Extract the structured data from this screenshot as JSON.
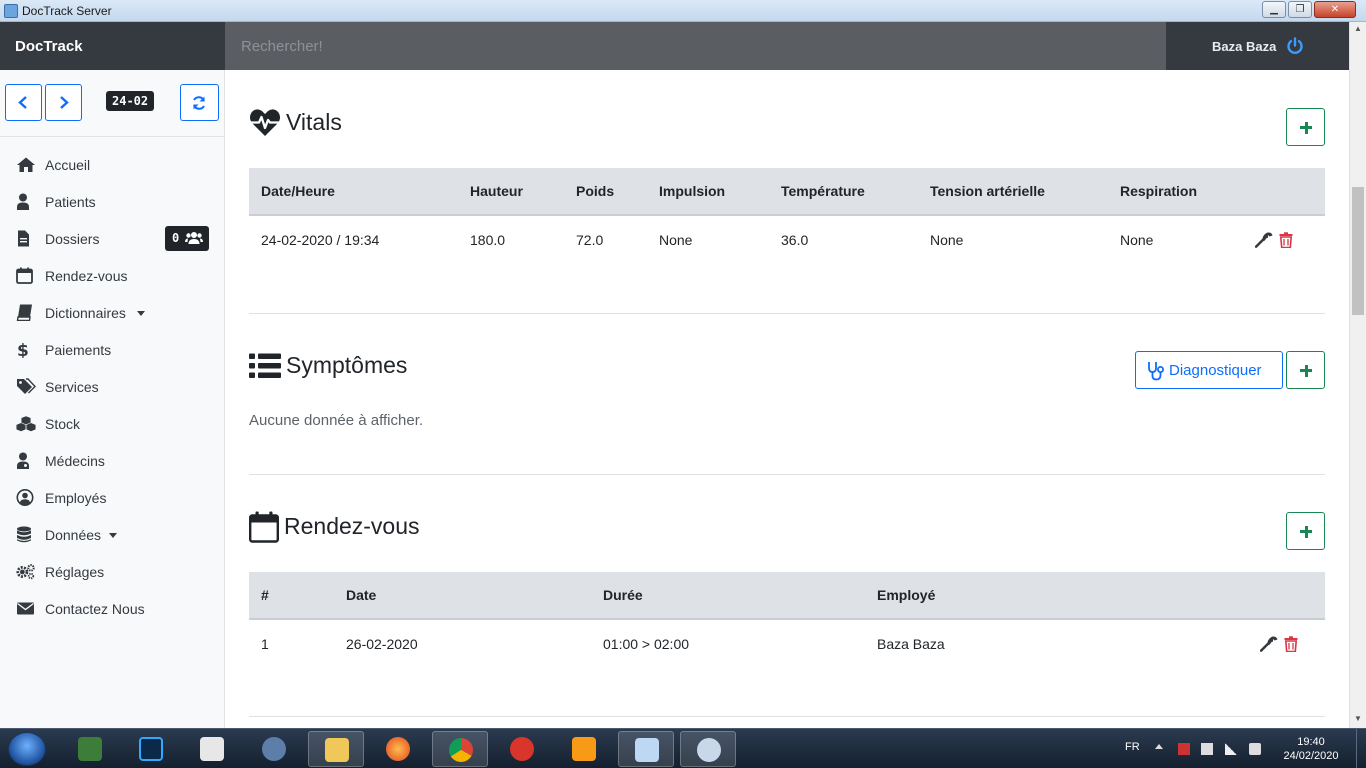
{
  "window": {
    "title": "DocTrack Server",
    "min": "▁",
    "max": "❐",
    "close": "✕"
  },
  "header": {
    "brand": "DocTrack",
    "search_placeholder": "Rechercher!",
    "user": "Baza Baza"
  },
  "sidebar": {
    "date": "24-02",
    "dossiers_count": "0",
    "items": [
      {
        "label": "Accueil",
        "icon": "home-icon"
      },
      {
        "label": "Patients",
        "icon": "user-icon"
      },
      {
        "label": "Dossiers",
        "icon": "file-icon"
      },
      {
        "label": "Rendez-vous",
        "icon": "calendar-icon"
      },
      {
        "label": "Dictionnaires",
        "icon": "book-icon"
      },
      {
        "label": "Paiements",
        "icon": "dollar-icon"
      },
      {
        "label": "Services",
        "icon": "tags-icon"
      },
      {
        "label": "Stock",
        "icon": "cubes-icon"
      },
      {
        "label": "Médecins",
        "icon": "doctor-icon"
      },
      {
        "label": "Employés",
        "icon": "user-circle-icon"
      },
      {
        "label": "Données",
        "icon": "database-icon"
      },
      {
        "label": "Réglages",
        "icon": "cogs-icon"
      },
      {
        "label": "Contactez Nous",
        "icon": "envelope-icon"
      }
    ]
  },
  "vitals": {
    "title": "Vitals",
    "headers": [
      "Date/Heure",
      "Hauteur",
      "Poids",
      "Impulsion",
      "Température",
      "Tension artérielle",
      "Respiration"
    ],
    "rows": [
      [
        "24-02-2020 / 19:34",
        "180.0",
        "72.0",
        "None",
        "36.0",
        "None",
        "None"
      ]
    ]
  },
  "symptomes": {
    "title": "Symptômes",
    "diagnose_label": "Diagnostiquer",
    "empty": "Aucune donnée à afficher."
  },
  "rendezvous": {
    "title": "Rendez-vous",
    "headers": [
      "#",
      "Date",
      "Durée",
      "Employé"
    ],
    "rows": [
      [
        "1",
        "26-02-2020",
        "01:00 > 02:00",
        "Baza Baza"
      ]
    ]
  },
  "taskbar": {
    "lang": "FR",
    "time": "19:40",
    "date": "24/02/2020"
  },
  "colors": {
    "header_bg": "#343a40",
    "primary": "#0d6efd",
    "success": "#198754",
    "danger": "#dc3545"
  }
}
